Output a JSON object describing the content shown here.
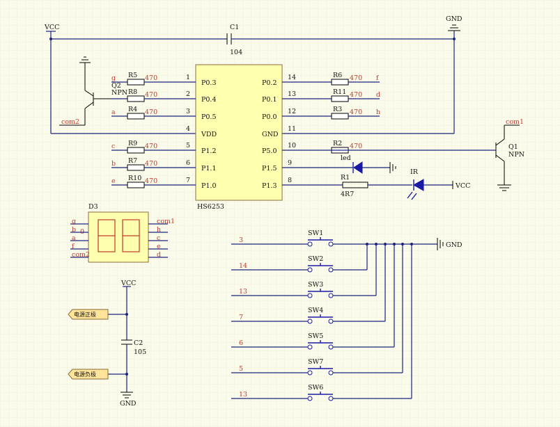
{
  "ic": {
    "name": "HS6253",
    "left_pins": [
      {
        "num": "1",
        "name": "P0.3",
        "net": "g",
        "res": "R5",
        "val": "470"
      },
      {
        "num": "2",
        "name": "P0.4",
        "net": "",
        "res": "R8",
        "val": "470"
      },
      {
        "num": "3",
        "name": "P0.5",
        "net": "a",
        "res": "R4",
        "val": "470"
      },
      {
        "num": "4",
        "name": "VDD",
        "net": "com2",
        "res": "",
        "val": ""
      },
      {
        "num": "5",
        "name": "P1.2",
        "net": "c",
        "res": "R9",
        "val": "470"
      },
      {
        "num": "6",
        "name": "P1.1",
        "net": "b",
        "res": "R7",
        "val": "470"
      },
      {
        "num": "7",
        "name": "P1.0",
        "net": "e",
        "res": "R10",
        "val": "470"
      }
    ],
    "right_pins": [
      {
        "num": "14",
        "name": "P0.2",
        "net": "f",
        "res": "R6",
        "val": "470"
      },
      {
        "num": "13",
        "name": "P0.1",
        "net": "d",
        "res": "R11",
        "val": "470"
      },
      {
        "num": "12",
        "name": "P0.0",
        "net": "h",
        "res": "R3",
        "val": "470"
      },
      {
        "num": "11",
        "name": "GND",
        "net": "",
        "res": "",
        "val": ""
      },
      {
        "num": "10",
        "name": "P5.0",
        "net": "",
        "res": "R2",
        "val": "470"
      },
      {
        "num": "9",
        "name": "P1.5",
        "net": "",
        "res": "",
        "val": ""
      },
      {
        "num": "8",
        "name": "P1.3",
        "net": "",
        "res": "R1",
        "val": "4R7"
      }
    ]
  },
  "power": {
    "vcc": "VCC",
    "gnd": "GND"
  },
  "c1": {
    "name": "C1",
    "val": "104"
  },
  "q2": {
    "name": "Q2",
    "type": "NPN"
  },
  "q1": {
    "name": "Q1",
    "type": "NPN",
    "net": "com1"
  },
  "led": {
    "label": "led"
  },
  "ir": {
    "label": "IR",
    "vcc": "VCC"
  },
  "display": {
    "name": "D3",
    "left_pins": [
      "g",
      "b",
      "a",
      "f",
      "com2"
    ],
    "right_pins": [
      "com1",
      "h",
      "c",
      "e",
      "d"
    ],
    "inner_label": "0"
  },
  "c2": {
    "name": "C2",
    "val": "105",
    "vcc": "VCC",
    "gnd": "GND"
  },
  "ports": {
    "pos": "电源正极",
    "neg": "电源负极"
  },
  "switches": [
    {
      "name": "SW1",
      "net": "3"
    },
    {
      "name": "SW2",
      "net": "14"
    },
    {
      "name": "SW3",
      "net": "13"
    },
    {
      "name": "SW4",
      "net": "7"
    },
    {
      "name": "SW5",
      "net": "6"
    },
    {
      "name": "SW7",
      "net": "5"
    },
    {
      "name": "SW6",
      "net": "13"
    }
  ],
  "switch_gnd": "GND"
}
